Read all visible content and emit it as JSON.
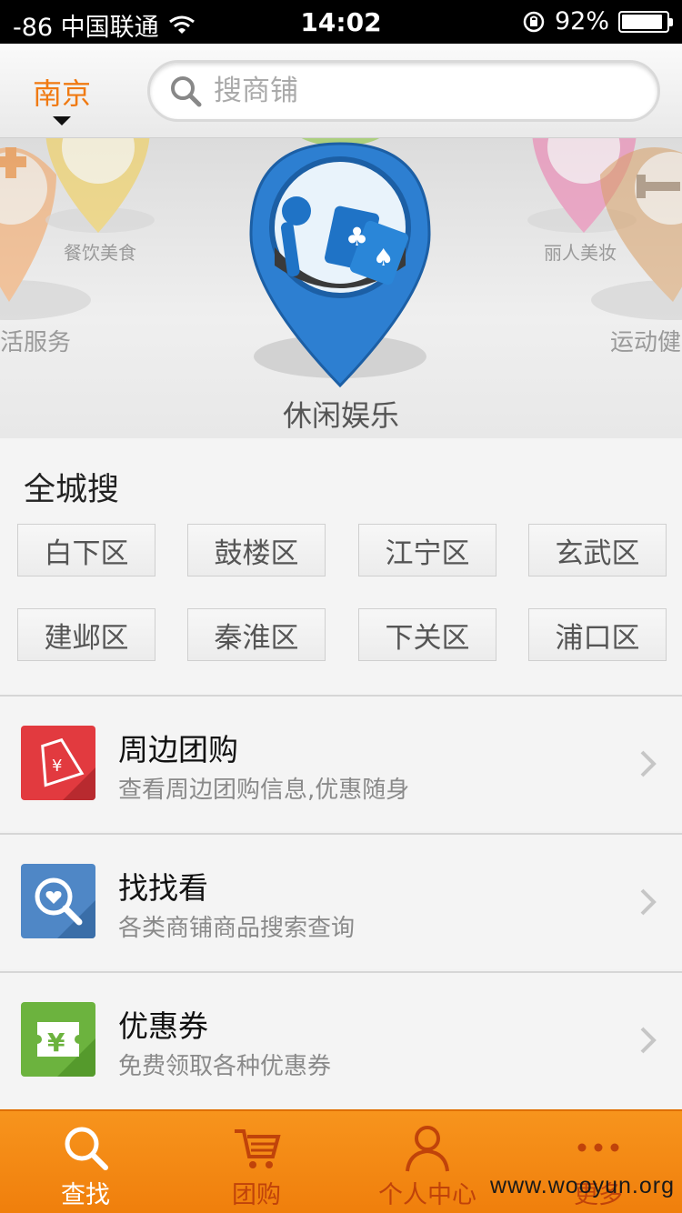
{
  "status_bar": {
    "carrier": "-86 中国联通",
    "time": "14:02",
    "battery_text": "92%",
    "battery_level": 0.92
  },
  "header": {
    "city": "南京",
    "search_placeholder": "搜商铺"
  },
  "carousel": {
    "active_label": "休闲娱乐",
    "side_labels": [
      "餐饮美食",
      "活服务",
      "丽人美妆",
      "运动健"
    ]
  },
  "city_search": {
    "title": "全城搜",
    "districts": [
      "白下区",
      "鼓楼区",
      "江宁区",
      "玄武区",
      "建邺区",
      "秦淮区",
      "下关区",
      "浦口区"
    ]
  },
  "menu": [
    {
      "title": "周边团购",
      "subtitle": "查看周边团购信息,优惠随身",
      "icon": "price-tag-icon",
      "color": "#e23a3f"
    },
    {
      "title": "找找看",
      "subtitle": "各类商铺商品搜索查询",
      "icon": "heart-search-icon",
      "color": "#4f87c6"
    },
    {
      "title": "优惠券",
      "subtitle": "免费领取各种优惠券",
      "icon": "coupon-yen-icon",
      "color": "#6cb33e"
    }
  ],
  "tabbar": {
    "tabs": [
      "查找",
      "团购",
      "个人中心",
      "更多"
    ],
    "active": 0
  },
  "watermark": "www.wooyun.org",
  "colors": {
    "accent": "#f07a12",
    "tabbar": "#f7941d",
    "pin_blue": "#2d7fd1"
  }
}
